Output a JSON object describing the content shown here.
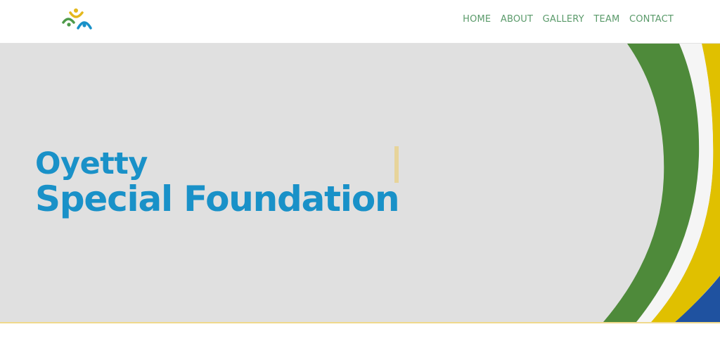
{
  "nav": {
    "items": [
      {
        "label": "HOME"
      },
      {
        "label": "ABOUT"
      },
      {
        "label": "GALLERY"
      },
      {
        "label": "TEAM"
      },
      {
        "label": "CONTACT"
      }
    ]
  },
  "hero": {
    "title_line1": "Oyetty",
    "title_line2": "Special Foundation"
  },
  "colors": {
    "nav_text": "#5a9a6a",
    "hero_bg": "#e0e0e0",
    "title": "#1991c8",
    "swoosh_green": "#4e8a3a",
    "swoosh_yellow": "#e0c000",
    "swoosh_blue": "#1f52a0",
    "cursor": "#e7d49a"
  },
  "icons": {
    "logo": "people-circle-logo"
  }
}
